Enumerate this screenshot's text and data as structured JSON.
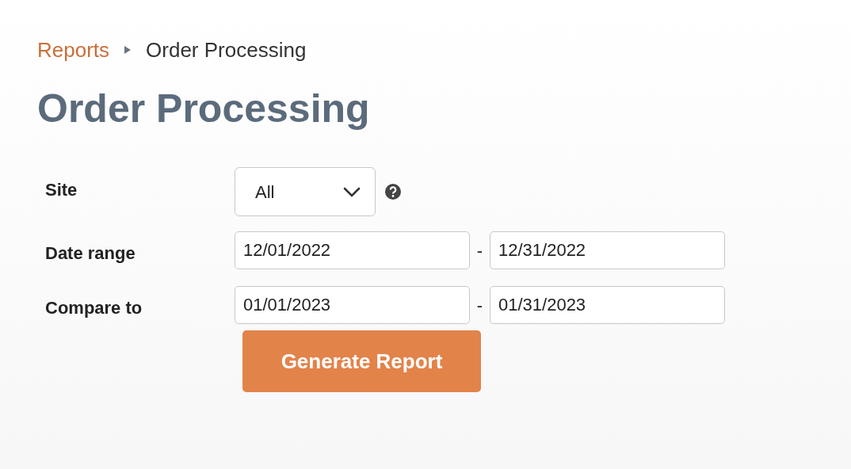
{
  "breadcrumb": [
    {
      "label": "Reports",
      "kind": "link"
    },
    {
      "label": "Order Processing",
      "kind": "current"
    }
  ],
  "title": "Order Processing",
  "form": [
    {
      "kind": "select",
      "label": "Site",
      "value": "All"
    },
    {
      "kind": "range",
      "label": "Date range",
      "from": "12/01/2022",
      "separator": "-",
      "to": "12/31/2022"
    },
    {
      "kind": "range",
      "label": "Compare to",
      "from": "01/01/2023",
      "separator": "-",
      "to": "01/31/2023"
    }
  ],
  "button": "Generate Report"
}
